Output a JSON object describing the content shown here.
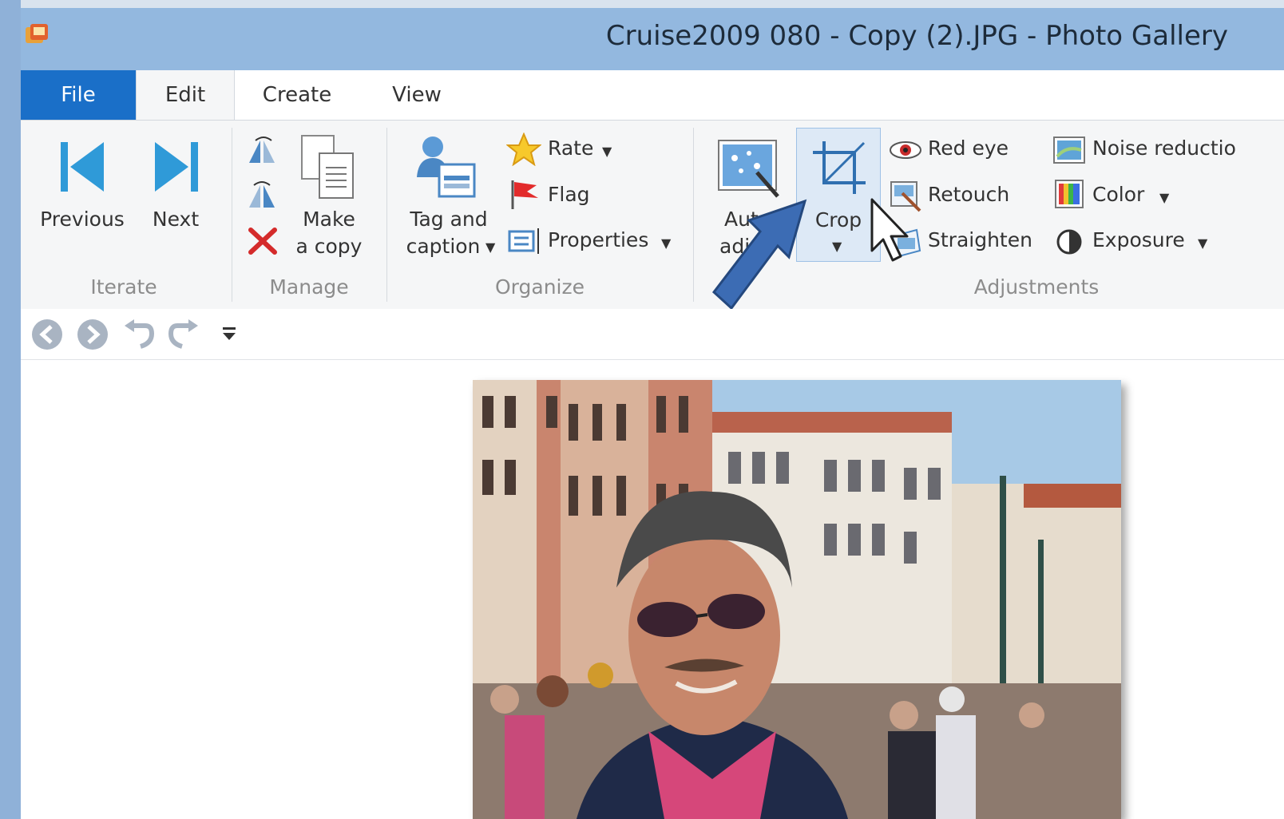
{
  "window": {
    "title": "Cruise2009 080 - Copy (2).JPG - Photo Gallery"
  },
  "tabs": [
    "File",
    "Edit",
    "Create",
    "View"
  ],
  "groups": {
    "iterate": {
      "label": "Iterate",
      "previous": "Previous",
      "next": "Next"
    },
    "manage": {
      "label": "Manage",
      "make_copy_line1": "Make",
      "make_copy_line2": "a copy"
    },
    "organize": {
      "label": "Organize",
      "tag_line1": "Tag and",
      "tag_line2": "caption",
      "rate": "Rate",
      "flag": "Flag",
      "properties": "Properties"
    },
    "adjustments": {
      "label": "Adjustments",
      "auto_line1": "Auto",
      "auto_line2": "adju",
      "crop": "Crop",
      "red_eye": "Red eye",
      "retouch": "Retouch",
      "straighten": "Straighten",
      "noise_reduction": "Noise reductio",
      "color": "Color",
      "exposure": "Exposure"
    }
  },
  "colors": {
    "file_tab": "#1a6fc8",
    "titlebar": "#93b8df",
    "arrow": "#3c6cb4"
  },
  "icons": [
    "app-icon",
    "previous-icon",
    "next-icon",
    "rotate-left-icon",
    "rotate-right-icon",
    "delete-icon",
    "copy-icon",
    "tag-icon",
    "star-icon",
    "flag-icon",
    "properties-icon",
    "auto-adjust-icon",
    "crop-icon",
    "red-eye-icon",
    "retouch-icon",
    "straighten-icon",
    "noise-reduction-icon",
    "color-icon",
    "exposure-icon",
    "back-icon",
    "forward-icon",
    "undo-icon",
    "redo-icon",
    "customize-icon"
  ]
}
